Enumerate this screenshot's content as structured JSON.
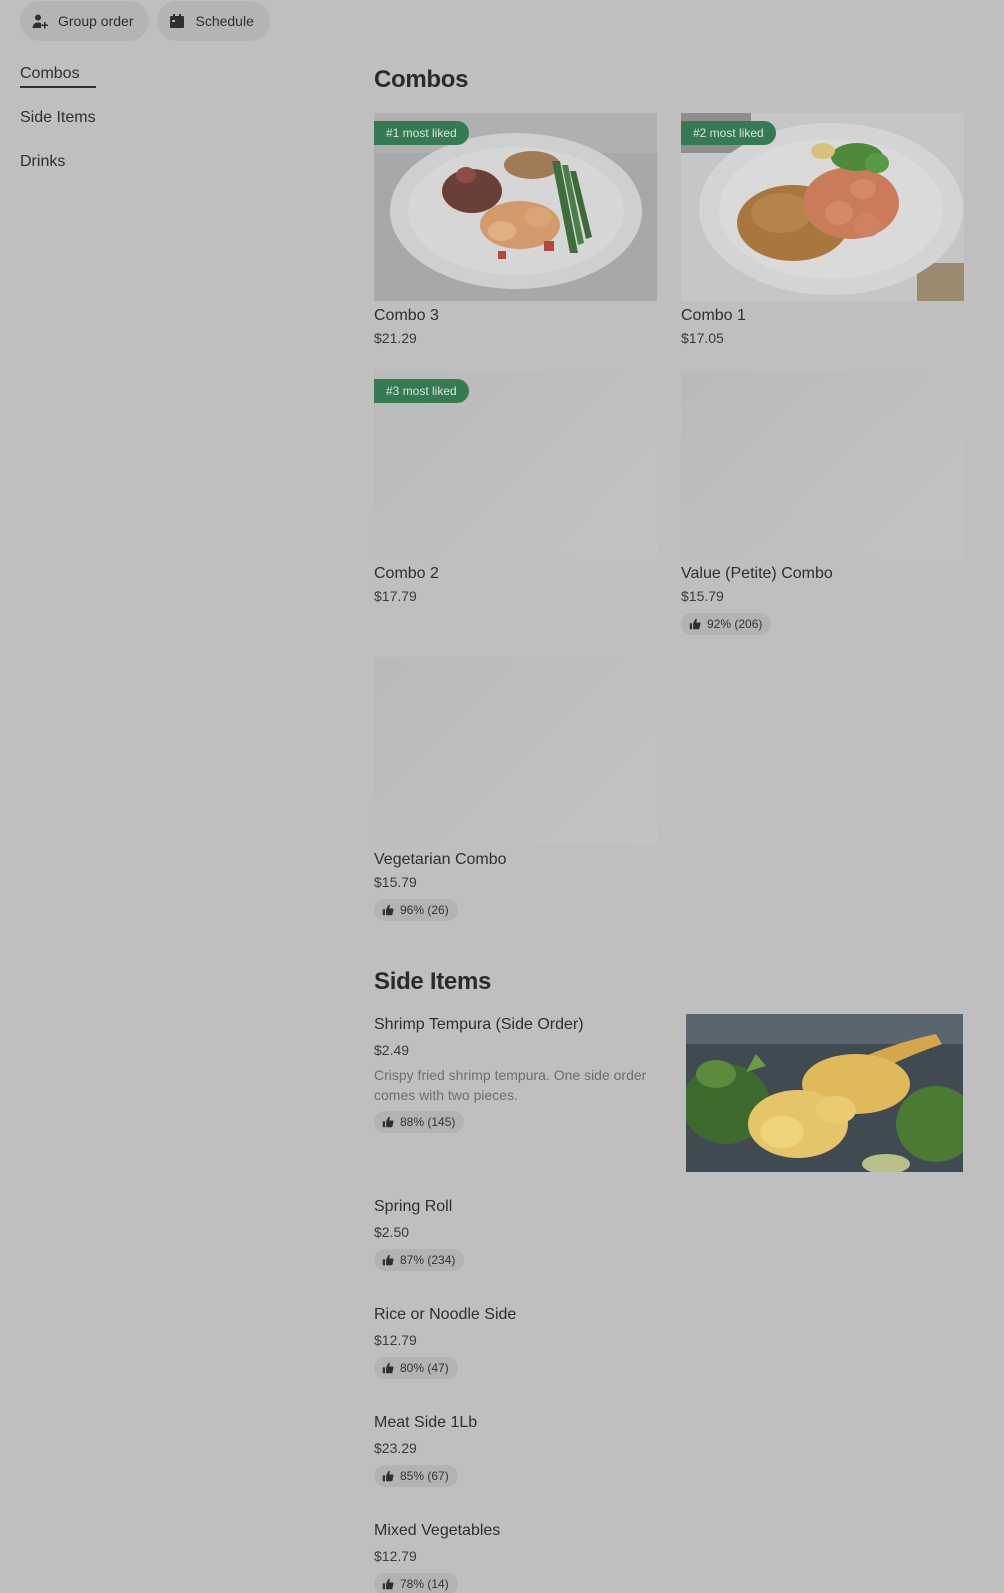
{
  "top_actions": {
    "group_order_label": "Group order",
    "schedule_label": "Schedule"
  },
  "nav": {
    "items": [
      {
        "label": "Combos",
        "active": true
      },
      {
        "label": "Side Items",
        "active": false
      },
      {
        "label": "Drinks",
        "active": false
      }
    ]
  },
  "combos": {
    "title": "Combos",
    "items": [
      {
        "name": "Combo 3",
        "price": "$21.29",
        "badge": "#1 most liked"
      },
      {
        "name": "Combo 1",
        "price": "$17.05",
        "badge": "#2 most liked"
      },
      {
        "name": "Combo 2",
        "price": "$17.79",
        "badge": "#3 most liked"
      },
      {
        "name": "Value (Petite) Combo",
        "price": "$15.79",
        "rating": "92% (206)"
      },
      {
        "name": "Vegetarian Combo",
        "price": "$15.79",
        "rating": "96% (26)"
      }
    ]
  },
  "side_items": {
    "title": "Side Items",
    "items": [
      {
        "name": "Shrimp Tempura (Side Order)",
        "price": "$2.49",
        "description": "Crispy fried shrimp tempura. One side order comes with two pieces.",
        "rating": "88% (145)"
      },
      {
        "name": "Spring Roll",
        "price": "$2.50",
        "rating": "87% (234)"
      },
      {
        "name": "Rice or Noodle Side",
        "price": "$12.79",
        "rating": "80% (47)"
      },
      {
        "name": "Meat Side 1Lb",
        "price": "$23.29",
        "rating": "85% (67)"
      },
      {
        "name": "Mixed Vegetables",
        "price": "$12.79",
        "rating": "78% (14)"
      }
    ]
  },
  "icons": {
    "group_order": "person-plus-icon",
    "schedule": "calendar-icon",
    "rating": "thumbs-up-icon"
  },
  "colors": {
    "page_background": "#bfbfbf",
    "badge_background": "#357a52",
    "pill_background": "#b4b4b4"
  }
}
